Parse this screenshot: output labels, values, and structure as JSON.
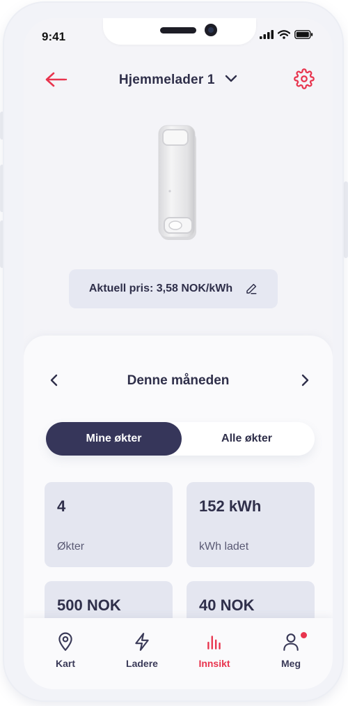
{
  "status_bar": {
    "time": "9:41"
  },
  "header": {
    "title": "Hjemmelader 1"
  },
  "price": {
    "label": "Aktuell pris: 3,58 NOK/kWh"
  },
  "period": {
    "label": "Denne måneden"
  },
  "toggle": {
    "mine": "Mine økter",
    "all": "Alle økter"
  },
  "stats": [
    {
      "value": "4",
      "caption": "Økter"
    },
    {
      "value": "152 kWh",
      "caption": "kWh ladet"
    },
    {
      "value": "500 NOK",
      "caption": ""
    },
    {
      "value": "40 NOK",
      "caption": ""
    }
  ],
  "tabs": [
    {
      "label": "Kart",
      "icon": "map-pin-icon"
    },
    {
      "label": "Ladere",
      "icon": "lightning-icon"
    },
    {
      "label": "Innsikt",
      "icon": "bar-chart-icon"
    },
    {
      "label": "Meg",
      "icon": "user-icon"
    }
  ],
  "colors": {
    "accent": "#e8344e",
    "primary": "#36365a",
    "tile": "#e4e6f0"
  }
}
